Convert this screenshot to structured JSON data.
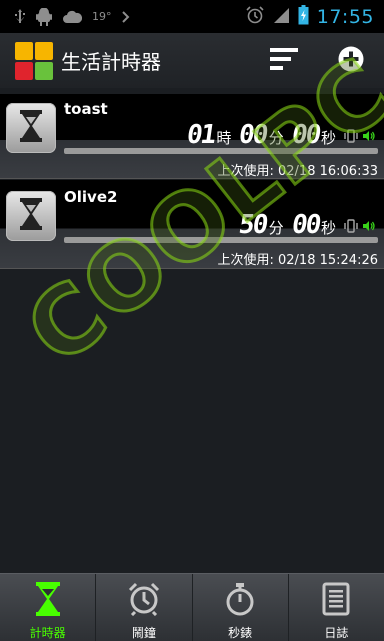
{
  "status_bar": {
    "temperature": "19°",
    "time": "17:55",
    "icons": [
      "usb-icon",
      "android-debug-icon",
      "cloud-icon",
      "chevron-right-icon",
      "alarm-clock-icon",
      "signal-icon",
      "battery-charging-icon"
    ]
  },
  "app": {
    "title": "生活計時器",
    "actions": [
      "sort-icon",
      "add-icon"
    ]
  },
  "timers": [
    {
      "name": "toast",
      "hours": "01",
      "hours_unit": "時",
      "minutes": "00",
      "minutes_unit": "分",
      "seconds": "00",
      "seconds_unit": "秒",
      "last_used": "上次使用: 02/18 16:06:33",
      "progress": 1.0
    },
    {
      "name": "Olive2",
      "minutes": "50",
      "minutes_unit": "分",
      "seconds": "00",
      "seconds_unit": "秒",
      "last_used": "上次使用: 02/18 15:24:26",
      "progress": 1.0
    }
  ],
  "watermark": "COOLPC",
  "tabs": [
    {
      "label": "計時器",
      "icon": "hourglass-icon",
      "active": true
    },
    {
      "label": "鬧鐘",
      "icon": "alarm-clock-icon",
      "active": false
    },
    {
      "label": "秒錶",
      "icon": "stopwatch-icon",
      "active": false
    },
    {
      "label": "日誌",
      "icon": "log-icon",
      "active": false
    }
  ],
  "colors": {
    "accent_green": "#48ff00",
    "clock_blue": "#33b5e5",
    "volume_green": "#39d21a"
  }
}
